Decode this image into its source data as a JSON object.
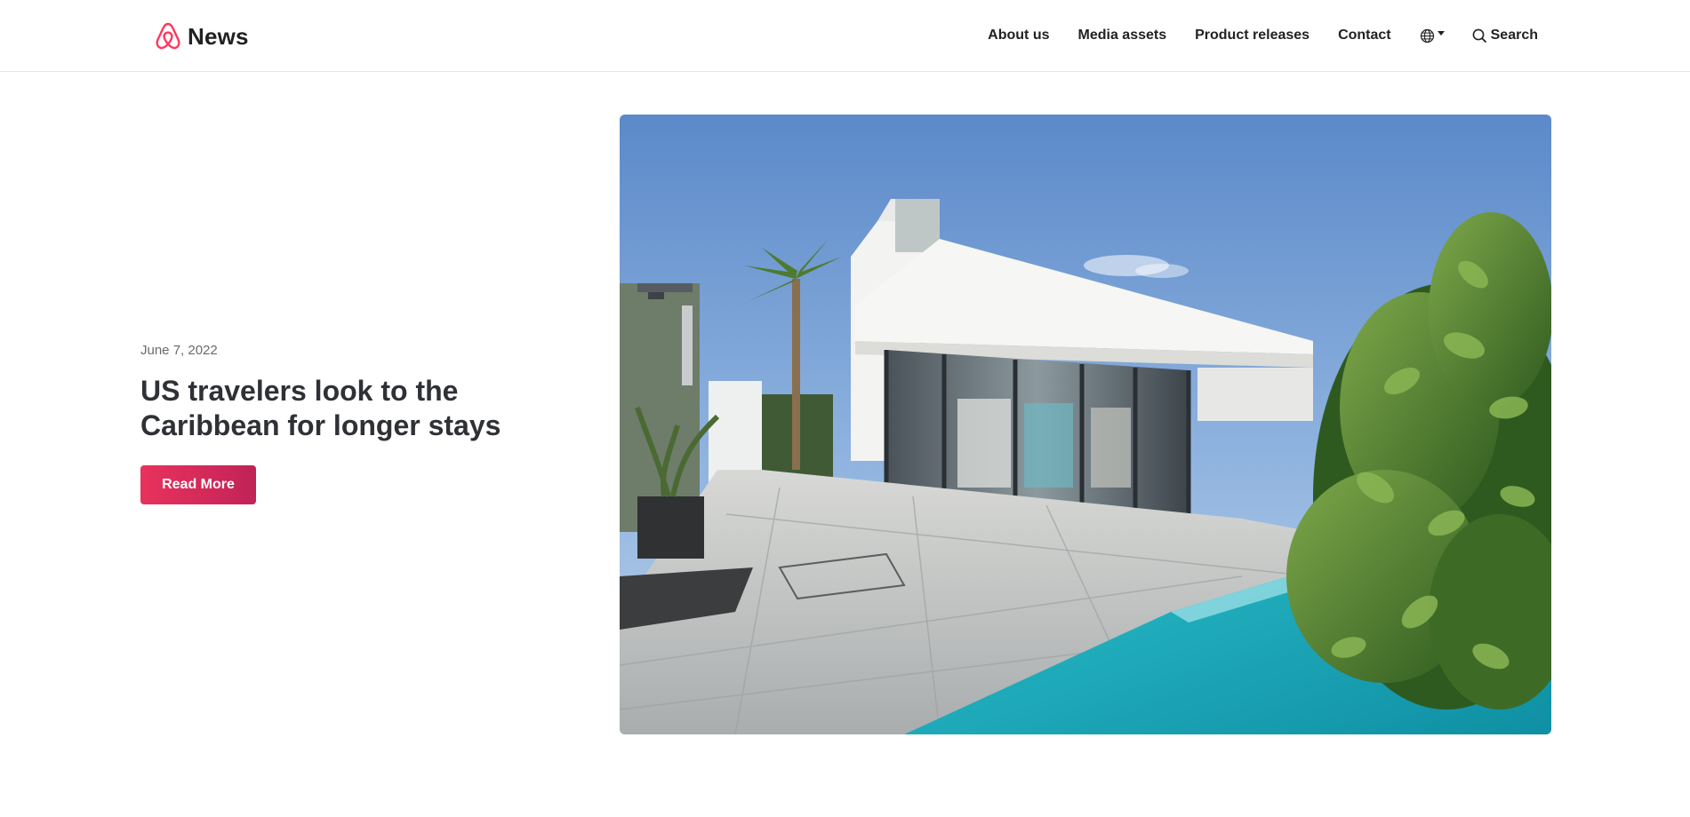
{
  "header": {
    "brand": "News",
    "nav": [
      {
        "label": "About us"
      },
      {
        "label": "Media assets"
      },
      {
        "label": "Product releases"
      },
      {
        "label": "Contact"
      }
    ],
    "language_icon": "globe-icon",
    "search_icon": "search-icon",
    "search_label": "Search"
  },
  "hero": {
    "date": "June 7, 2022",
    "title": "US travelers look to the Caribbean for longer stays",
    "cta": "Read More",
    "image_subject": "modern white villa with pool and glass walls"
  },
  "colors": {
    "brand": "#ff385c",
    "button_start": "#e8325c",
    "button_end": "#bf2358",
    "text": "#222222",
    "title": "#2f3136",
    "muted": "#6a6a6a"
  }
}
